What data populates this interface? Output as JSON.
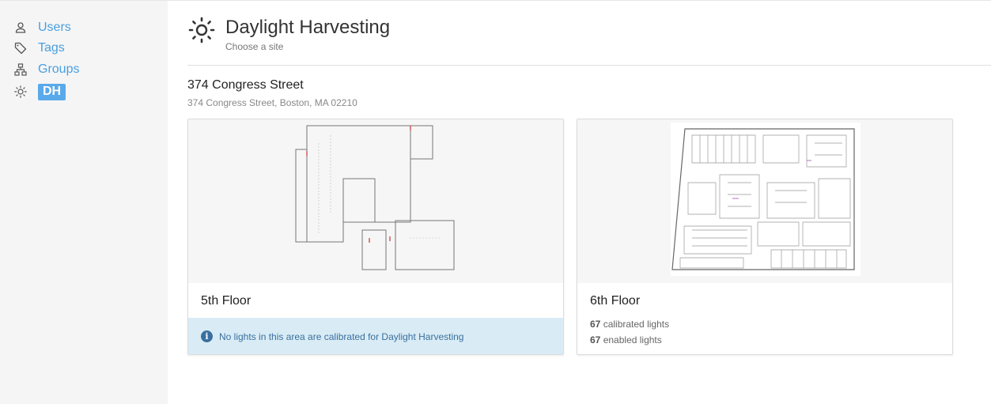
{
  "sidebar": {
    "items": [
      {
        "label": "Users",
        "icon": "user-icon"
      },
      {
        "label": "Tags",
        "icon": "tag-icon"
      },
      {
        "label": "Groups",
        "icon": "hierarchy-icon"
      },
      {
        "label": "DH",
        "icon": "sun-icon",
        "active": true
      }
    ]
  },
  "header": {
    "title": "Daylight Harvesting",
    "subtitle": "Choose a site",
    "icon": "sun-icon"
  },
  "site": {
    "name": "374 Congress Street",
    "address": "374 Congress Street, Boston, MA 02210"
  },
  "floors": [
    {
      "name": "5th Floor",
      "notice": "No lights in this area are calibrated for Daylight Harvesting"
    },
    {
      "name": "6th Floor",
      "calibrated_count": "67",
      "calibrated_label": "calibrated lights",
      "enabled_count": "67",
      "enabled_label": "enabled lights"
    }
  ],
  "colors": {
    "link": "#4a9fe0",
    "active_badge": "#5aa9ea",
    "info_bg": "#d9ecf5",
    "info_text": "#3a6f9e"
  }
}
